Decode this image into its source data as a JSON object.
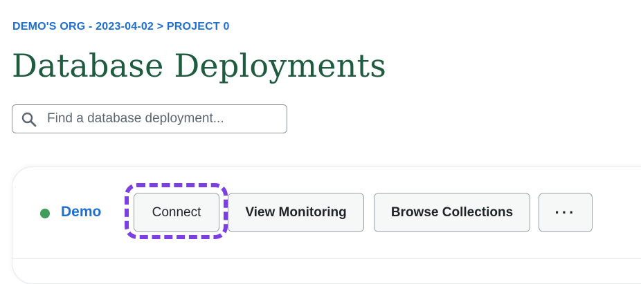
{
  "breadcrumb": {
    "text": "DEMO'S ORG - 2023-04-02 > PROJECT 0"
  },
  "page": {
    "title": "Database Deployments"
  },
  "search": {
    "placeholder": "Find a database deployment...",
    "value": "",
    "icon": "search-icon"
  },
  "cluster": {
    "name": "Demo",
    "status_color": "#3f9c5b",
    "buttons": {
      "connect": "Connect",
      "view_monitoring": "View Monitoring",
      "browse_collections": "Browse Collections",
      "more": "···"
    },
    "highlight_color": "#7b3fe4"
  },
  "colors": {
    "link_blue": "#1f6fd1",
    "title_green": "#1f5b3f"
  }
}
